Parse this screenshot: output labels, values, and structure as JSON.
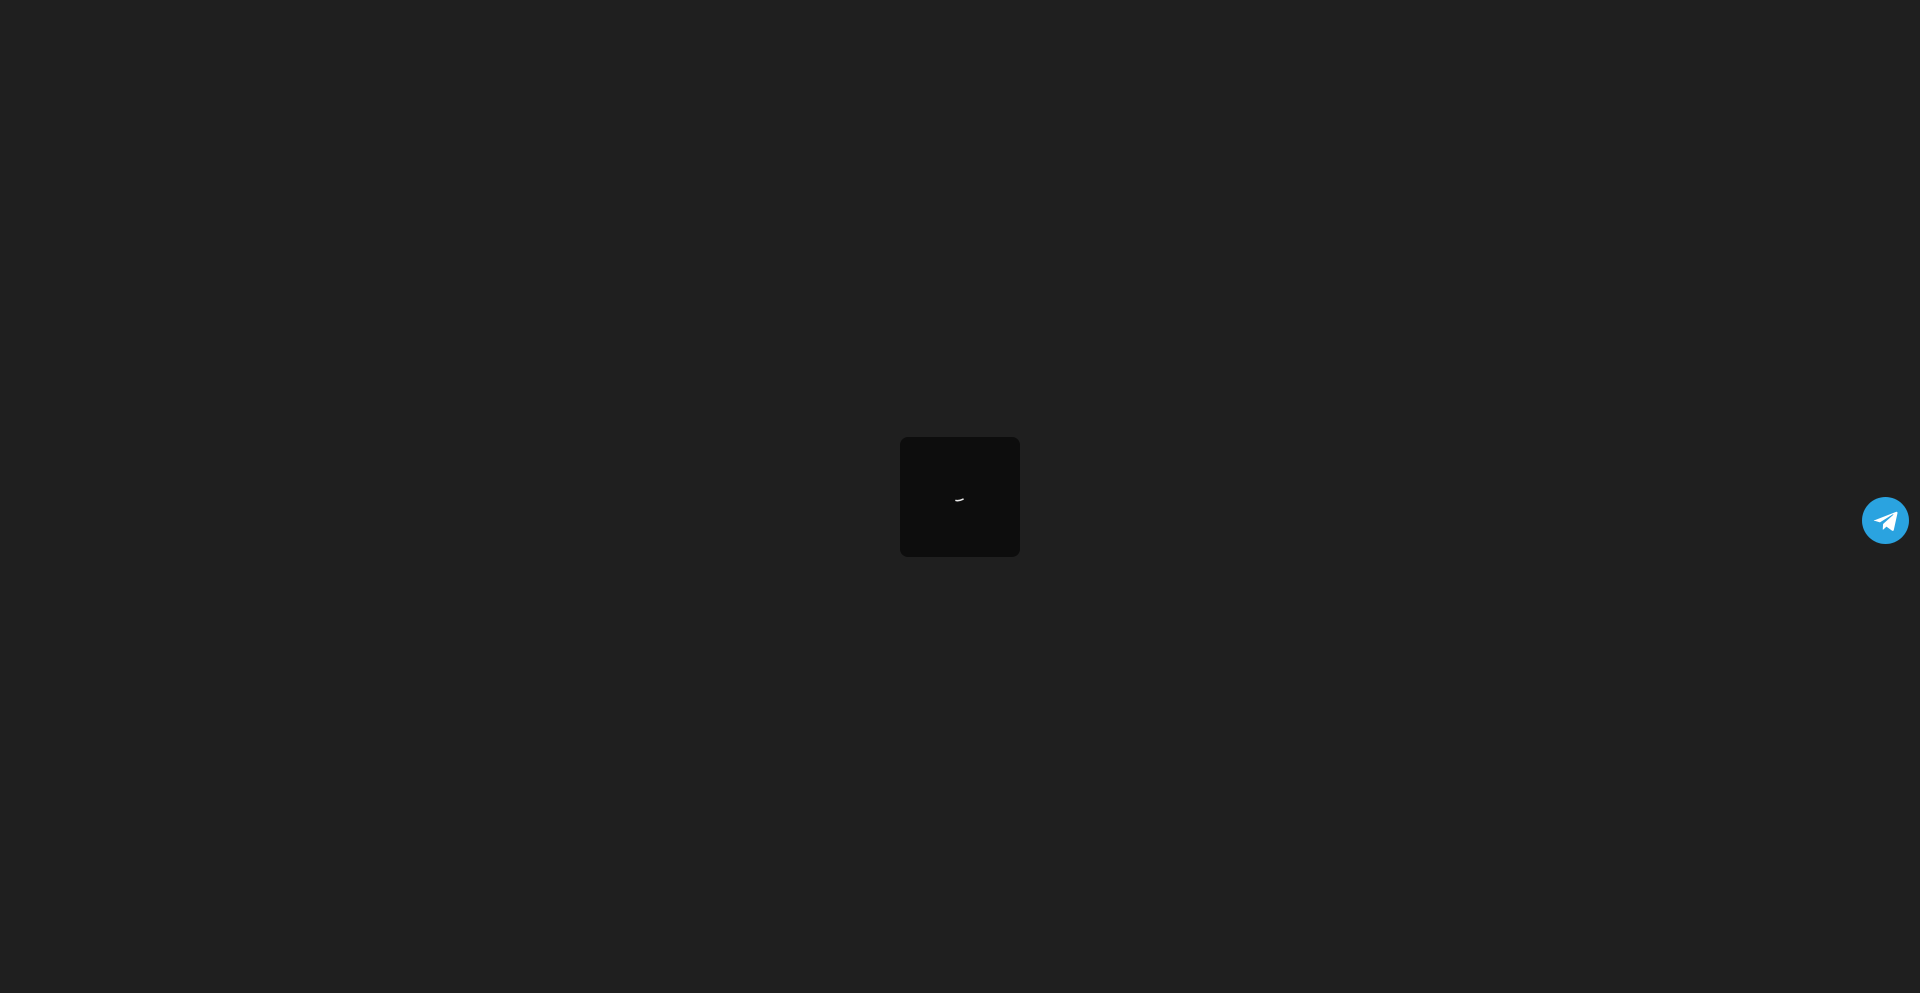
{
  "colors": {
    "page_background": "#1f1f1f",
    "loader_card_background": "#0d0d0d",
    "spinner_color": "#e8e8e8",
    "telegram_brand": "#2aa3e0"
  },
  "icons": {
    "spinner": "loading-spinner-icon",
    "telegram": "telegram-paper-plane-icon"
  }
}
